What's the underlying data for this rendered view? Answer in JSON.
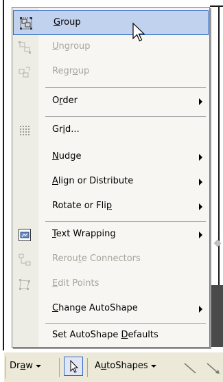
{
  "menu": {
    "items": [
      {
        "key": "group",
        "pre": "",
        "u": "G",
        "post": "roup",
        "disabled": false,
        "submenu": false,
        "icon": "group-icon"
      },
      {
        "key": "ungroup",
        "pre": "",
        "u": "U",
        "post": "ngroup",
        "disabled": true,
        "submenu": false,
        "icon": "ungroup-icon"
      },
      {
        "key": "regroup",
        "pre": "Regr",
        "u": "o",
        "post": "up",
        "disabled": true,
        "submenu": false,
        "icon": "regroup-icon"
      },
      {
        "key": "order",
        "pre": "O",
        "u": "r",
        "post": "der",
        "disabled": false,
        "submenu": true,
        "icon": ""
      },
      {
        "key": "grid",
        "pre": "Gr",
        "u": "i",
        "post": "d...",
        "disabled": false,
        "submenu": false,
        "icon": "grid-icon"
      },
      {
        "key": "nudge",
        "pre": "",
        "u": "N",
        "post": "udge",
        "disabled": false,
        "submenu": true,
        "icon": ""
      },
      {
        "key": "align",
        "pre": "",
        "u": "A",
        "post": "lign or Distribute",
        "disabled": false,
        "submenu": true,
        "icon": ""
      },
      {
        "key": "rotate",
        "pre": "Rotate or Fli",
        "u": "p",
        "post": "",
        "disabled": false,
        "submenu": true,
        "icon": ""
      },
      {
        "key": "textwrap",
        "pre": "",
        "u": "T",
        "post": "ext Wrapping",
        "disabled": false,
        "submenu": true,
        "icon": "text-wrapping-icon"
      },
      {
        "key": "reroute",
        "pre": "Rerou",
        "u": "t",
        "post": "e Connectors",
        "disabled": true,
        "submenu": false,
        "icon": "reroute-connectors-icon"
      },
      {
        "key": "editpoints",
        "pre": "",
        "u": "E",
        "post": "dit Points",
        "disabled": true,
        "submenu": false,
        "icon": "edit-points-icon"
      },
      {
        "key": "changeauto",
        "pre": "",
        "u": "C",
        "post": "hange AutoShape",
        "disabled": false,
        "submenu": true,
        "icon": ""
      },
      {
        "key": "setdefaults",
        "pre": "Set AutoShape ",
        "u": "D",
        "post": "efaults",
        "disabled": false,
        "submenu": false,
        "icon": ""
      }
    ]
  },
  "toolbar": {
    "draw_pre": "Dr",
    "draw_u": "a",
    "draw_post": "w",
    "autoshapes_pre": "A",
    "autoshapes_u": "u",
    "autoshapes_post": "toShapes"
  },
  "colors": {
    "highlight": "#c1d2ee",
    "highlight_border": "#316ac5",
    "disabled_text": "#a6a59d"
  }
}
